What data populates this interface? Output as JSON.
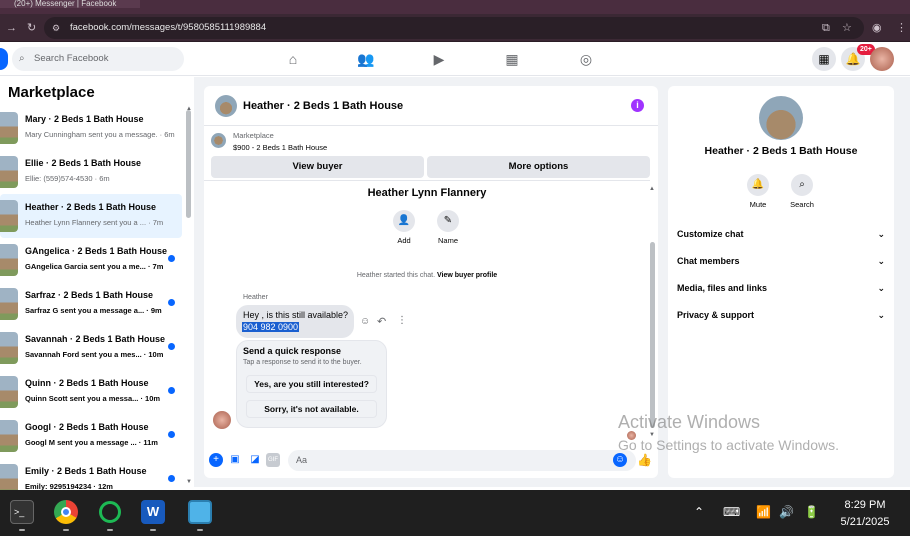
{
  "browser": {
    "tab_title": "(20+) Messenger | Facebook",
    "url": "facebook.com/messages/t/9580585111989884"
  },
  "header": {
    "search_placeholder": "Search Facebook",
    "notifications_badge": "20+"
  },
  "sidebar": {
    "title": "Marketplace",
    "conversations": [
      {
        "name": "Mary · 2 Beds 1 Bath House",
        "preview": "Mary Cunningham sent you a message. · 6m",
        "unread": false
      },
      {
        "name": "Ellie · 2 Beds 1 Bath House",
        "preview": "Ellie: (559)574-4530 · 6m",
        "unread": false
      },
      {
        "name": "Heather · 2 Beds 1 Bath House",
        "preview": "Heather Lynn Flannery sent you a ... · 7m",
        "unread": false
      },
      {
        "name": "GAngelica · 2 Beds 1 Bath House",
        "preview": "GAngelica Garcia sent you a me... · 7m",
        "unread": true
      },
      {
        "name": "Sarfraz · 2 Beds 1 Bath House",
        "preview": "Sarfraz G sent you a message a... · 9m",
        "unread": true
      },
      {
        "name": "Savannah · 2 Beds 1 Bath House",
        "preview": "Savannah Ford sent you a mes... · 10m",
        "unread": true
      },
      {
        "name": "Quinn · 2 Beds 1 Bath House",
        "preview": "Quinn Scott sent you a messa... · 10m",
        "unread": true
      },
      {
        "name": "Googl · 2 Beds 1 Bath House",
        "preview": "Googl M sent you a message ... · 11m",
        "unread": true
      },
      {
        "name": "Emily · 2 Beds 1 Bath House",
        "preview": "Emily: 9295194234 · 12m",
        "unread": true
      }
    ]
  },
  "chat": {
    "title": "Heather · 2 Beds 1 Bath House",
    "marketplace_label": "Marketplace",
    "listing": "$900 - 2 Beds 1 Bath House",
    "view_buyer": "View buyer",
    "more_options": "More options",
    "buyer_name": "Heather Lynn Flannery",
    "add_label": "Add",
    "name_label": "Name",
    "started_text": "Heather started this chat.",
    "view_profile": "View buyer profile",
    "sender": "Heather",
    "message_line1": "Hey , is this still available?",
    "message_line2": "904 982 0900",
    "quick_title": "Send a quick response",
    "quick_sub": "Tap a response to send it to the buyer.",
    "quick_1": "Yes, are you still interested?",
    "quick_2": "Sorry, it's not available.",
    "composer_placeholder": "Aa",
    "gif_label": "GIF"
  },
  "info_panel": {
    "name": "Heather · 2 Beds 1 Bath House",
    "mute": "Mute",
    "search": "Search",
    "sections": [
      "Customize chat",
      "Chat members",
      "Media, files and links",
      "Privacy & support"
    ]
  },
  "watermark": {
    "line1": "Activate Windows",
    "line2": "Go to Settings to activate Windows."
  },
  "taskbar": {
    "time": "8:29 PM",
    "date": "5/21/2025"
  },
  "colors": {
    "accent": "#0866ff",
    "info_icon": "#a033ff"
  }
}
